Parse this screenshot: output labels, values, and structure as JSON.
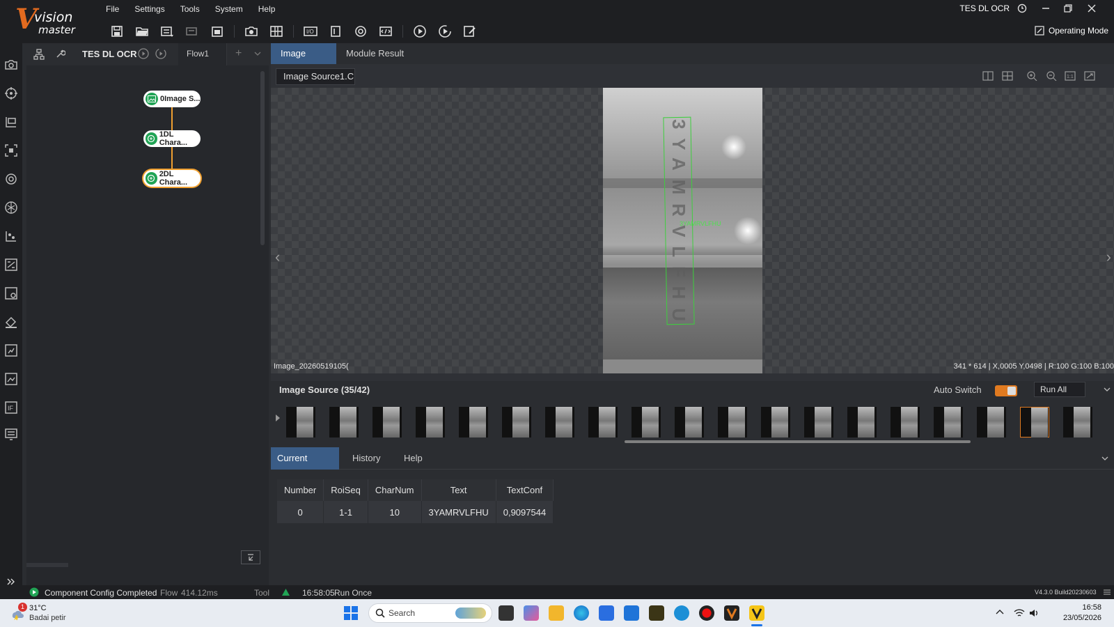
{
  "app": {
    "logo_line1": "vision",
    "logo_line2": "master",
    "window_title": "TES DL OCR",
    "operating_mode": "Operating Mode"
  },
  "menu": [
    "File",
    "Settings",
    "Tools",
    "System",
    "Help"
  ],
  "flow": {
    "solution_name": "TES DL OCR",
    "flow_tab": "Flow1",
    "nodes": [
      {
        "label": "0Image S..."
      },
      {
        "label": "1DL Chara..."
      },
      {
        "label": "2DL Chara..."
      }
    ]
  },
  "image_panel": {
    "tabs": [
      "Image Data",
      "Module Result"
    ],
    "source_select": "Image Source1.C",
    "ocr_overlay_text": "3YAMRVLFHU",
    "filename": "Image_20260519105(",
    "info": "341 * 614  |  X,0005  Y,0498  |  R:100  G:100  B:100"
  },
  "filmstrip": {
    "title": "Image Source (35/42)",
    "auto_switch_label": "Auto Switch",
    "run_mode": "Run All"
  },
  "results": {
    "tabs": [
      "Current Result",
      "History",
      "Help"
    ],
    "columns": [
      "Number",
      "RoiSeq",
      "CharNum",
      "Text",
      "TextConf"
    ],
    "rows": [
      [
        "0",
        "1-1",
        "10",
        "3YAMRVLFHU",
        "0,9097544"
      ]
    ]
  },
  "status": {
    "message": "Component Config Completed",
    "flow_label": "Flow",
    "flow_time": "414.12ms",
    "tool_label": "Tool",
    "run_time": "16:58:05",
    "run_mode": "Run Once",
    "version": "V4.3.0 Build20230603"
  },
  "taskbar": {
    "weather_temp": "31°C",
    "weather_desc": "Badai petir",
    "weather_badge": "1",
    "search_placeholder": "Search",
    "time": "16:58",
    "date": "23/05/2026"
  },
  "colors": {
    "accent_orange": "#e07a20",
    "tab_active": "#3a5c86",
    "node_green": "#21a455",
    "ocr_green": "#3ecf3e"
  }
}
